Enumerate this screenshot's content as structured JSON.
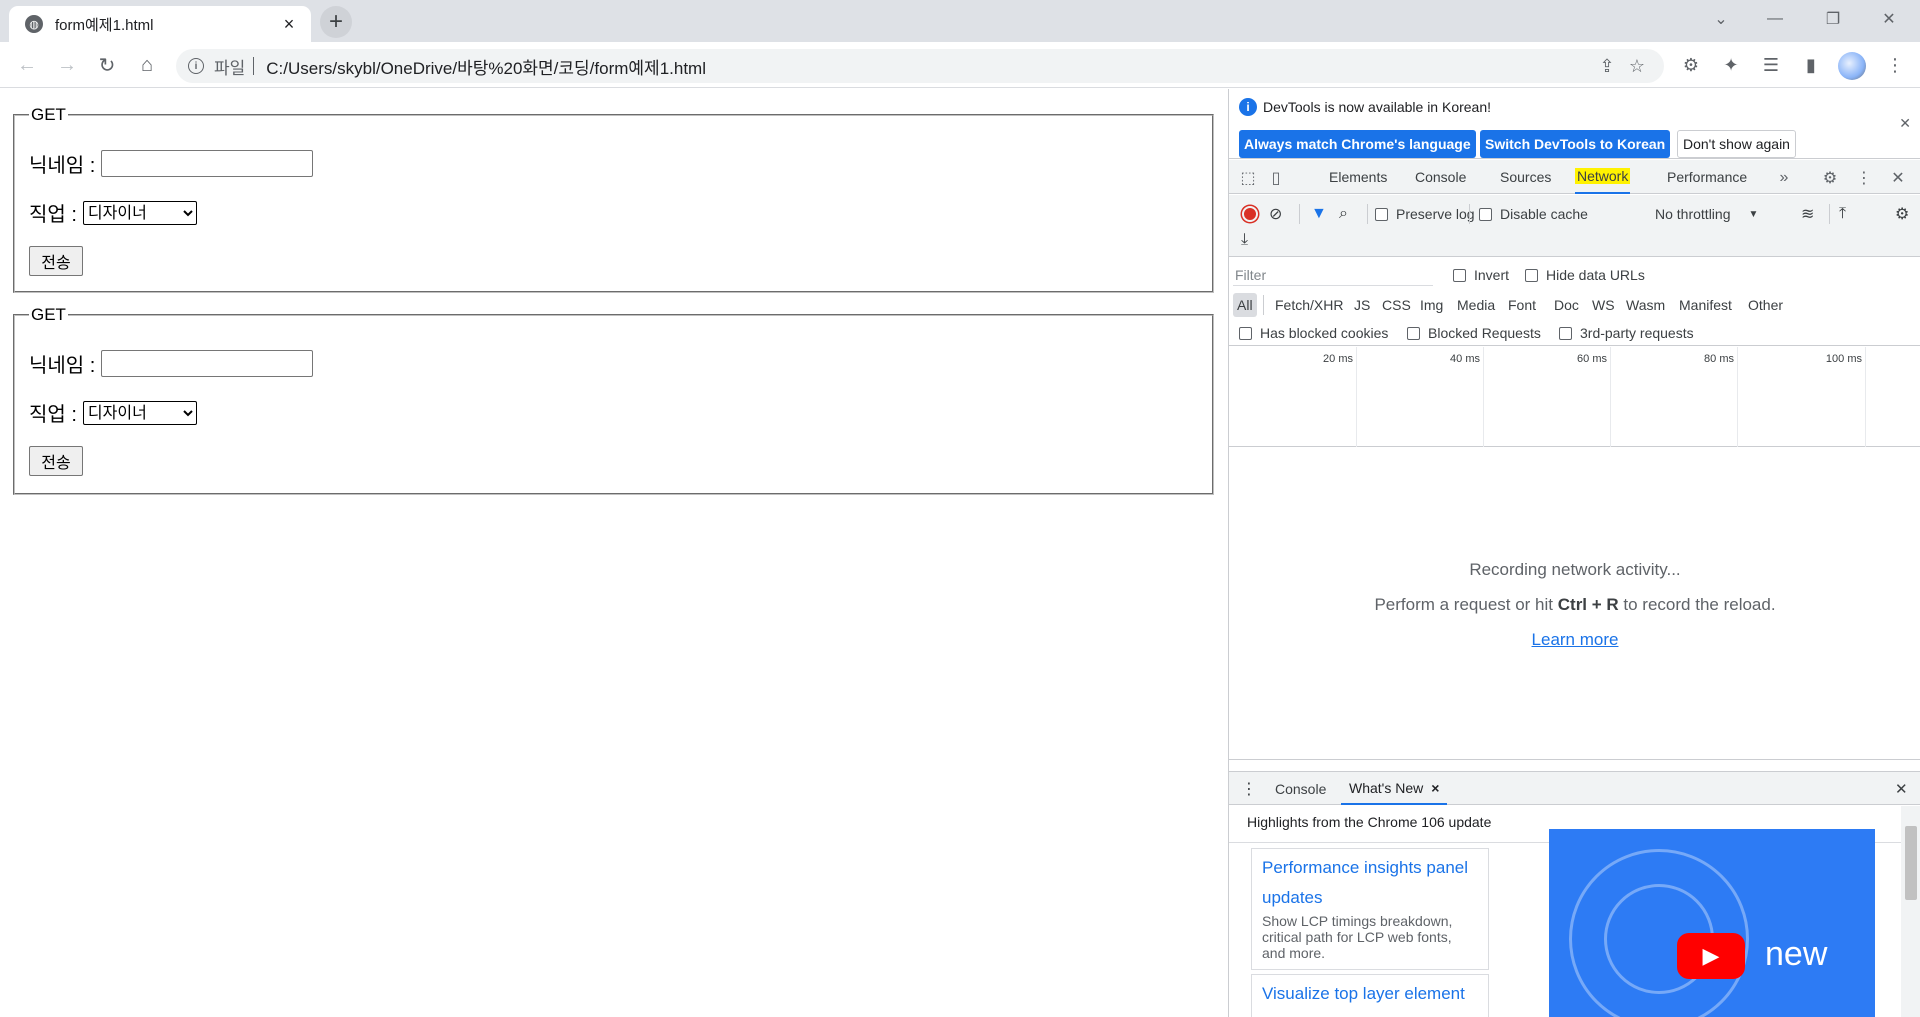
{
  "browser": {
    "tab_title": "form예제1.html",
    "omnibox": {
      "scheme": "파일",
      "url": "C:/Users/skybl/OneDrive/바탕%20화면/코딩/form예제1.html"
    }
  },
  "page": {
    "forms": [
      {
        "legend": "GET",
        "nickname_label": "닉네임 :",
        "nickname_value": "",
        "job_label": "직업 :",
        "job_selected": "디자이너",
        "submit_label": "전송"
      },
      {
        "legend": "GET",
        "nickname_label": "닉네임 :",
        "nickname_value": "",
        "job_label": "직업 :",
        "job_selected": "디자이너",
        "submit_label": "전송"
      }
    ]
  },
  "devtools": {
    "infobar": {
      "message": "DevTools is now available in Korean!",
      "btn_match": "Always match Chrome's language",
      "btn_switch": "Switch DevTools to Korean",
      "btn_dismiss": "Don't show again"
    },
    "tabs": [
      "Elements",
      "Console",
      "Sources",
      "Network",
      "Performance"
    ],
    "active_tab": "Network",
    "network": {
      "preserve_log": "Preserve log",
      "disable_cache": "Disable cache",
      "throttling": "No throttling",
      "filter_placeholder": "Filter",
      "invert": "Invert",
      "hide_data_urls": "Hide data URLs",
      "types": [
        "All",
        "Fetch/XHR",
        "JS",
        "CSS",
        "Img",
        "Media",
        "Font",
        "Doc",
        "WS",
        "Wasm",
        "Manifest",
        "Other"
      ],
      "has_blocked_cookies": "Has blocked cookies",
      "blocked_requests": "Blocked Requests",
      "third_party": "3rd-party requests",
      "timeline_ticks": [
        "20 ms",
        "40 ms",
        "60 ms",
        "80 ms",
        "100 ms"
      ],
      "empty": {
        "line1": "Recording network activity...",
        "line2_pre": "Perform a request or hit ",
        "line2_keys": "Ctrl + R",
        "line2_post": " to record the reload.",
        "learn_more": "Learn more"
      }
    },
    "drawer": {
      "tabs": [
        "Console",
        "What's New"
      ],
      "headline": "Highlights from the Chrome 106 update",
      "cards": [
        {
          "title": "Performance insights panel updates",
          "desc": "Show LCP timings breakdown, critical path for LCP web fonts, and more."
        },
        {
          "title": "Visualize top layer element",
          "desc": ""
        }
      ],
      "video_text": "new"
    }
  }
}
